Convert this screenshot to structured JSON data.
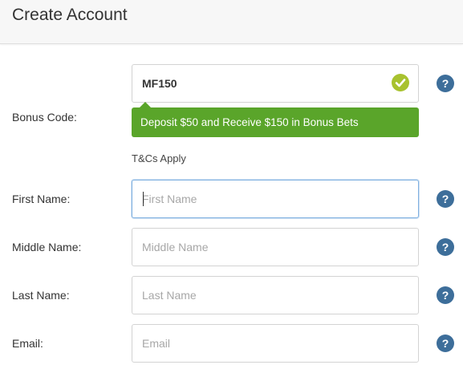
{
  "header": {
    "title": "Create Account"
  },
  "form": {
    "bonus_code": {
      "label": "Bonus Code:",
      "value": "MF150",
      "status_icon": "check-icon",
      "tooltip": "Deposit $50 and Receive $150 in Bonus Bets",
      "terms": "T&Cs Apply"
    },
    "first_name": {
      "label": "First Name:",
      "placeholder": "First Name"
    },
    "middle_name": {
      "label": "Middle Name:",
      "placeholder": "Middle Name"
    },
    "last_name": {
      "label": "Last Name:",
      "placeholder": "Last Name"
    },
    "email": {
      "label": "Email:",
      "placeholder": "Email"
    },
    "help_glyph": "?"
  },
  "colors": {
    "success_green": "#5aa52a",
    "check_green": "#a8c22f",
    "help_blue": "#3d6e9a",
    "focus_border": "#7fb0e0"
  }
}
